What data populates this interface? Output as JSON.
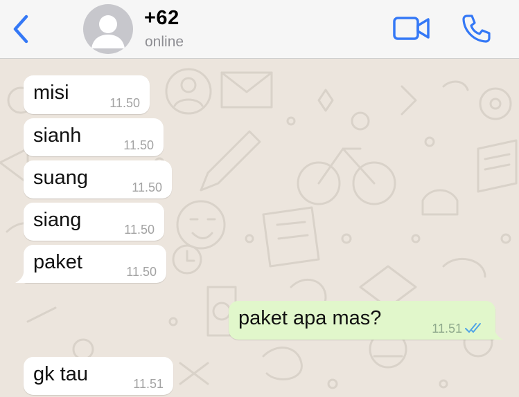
{
  "header": {
    "contact_name": "+62",
    "contact_status": "online",
    "accent_color": "#3478f6",
    "icons": [
      "chevron-left-icon",
      "avatar-placeholder-icon",
      "video-camera-icon",
      "phone-icon"
    ]
  },
  "messages": [
    {
      "direction": "incoming",
      "text": "misi",
      "time": "11.50"
    },
    {
      "direction": "incoming",
      "text": "sianh",
      "time": "11.50"
    },
    {
      "direction": "incoming",
      "text": "suang",
      "time": "11.50"
    },
    {
      "direction": "incoming",
      "text": "siang",
      "time": "11.50"
    },
    {
      "direction": "incoming",
      "text": "paket",
      "time": "11.50"
    },
    {
      "direction": "outgoing",
      "text": "paket apa mas?",
      "time": "11.51",
      "status": "read"
    },
    {
      "direction": "incoming",
      "text": "gk tau",
      "time": "11.51"
    }
  ],
  "colors": {
    "incoming_bubble": "#ffffff",
    "outgoing_bubble": "#e1f7cb",
    "chat_background": "#ece5dd",
    "read_ticks": "#4fa3e6"
  }
}
